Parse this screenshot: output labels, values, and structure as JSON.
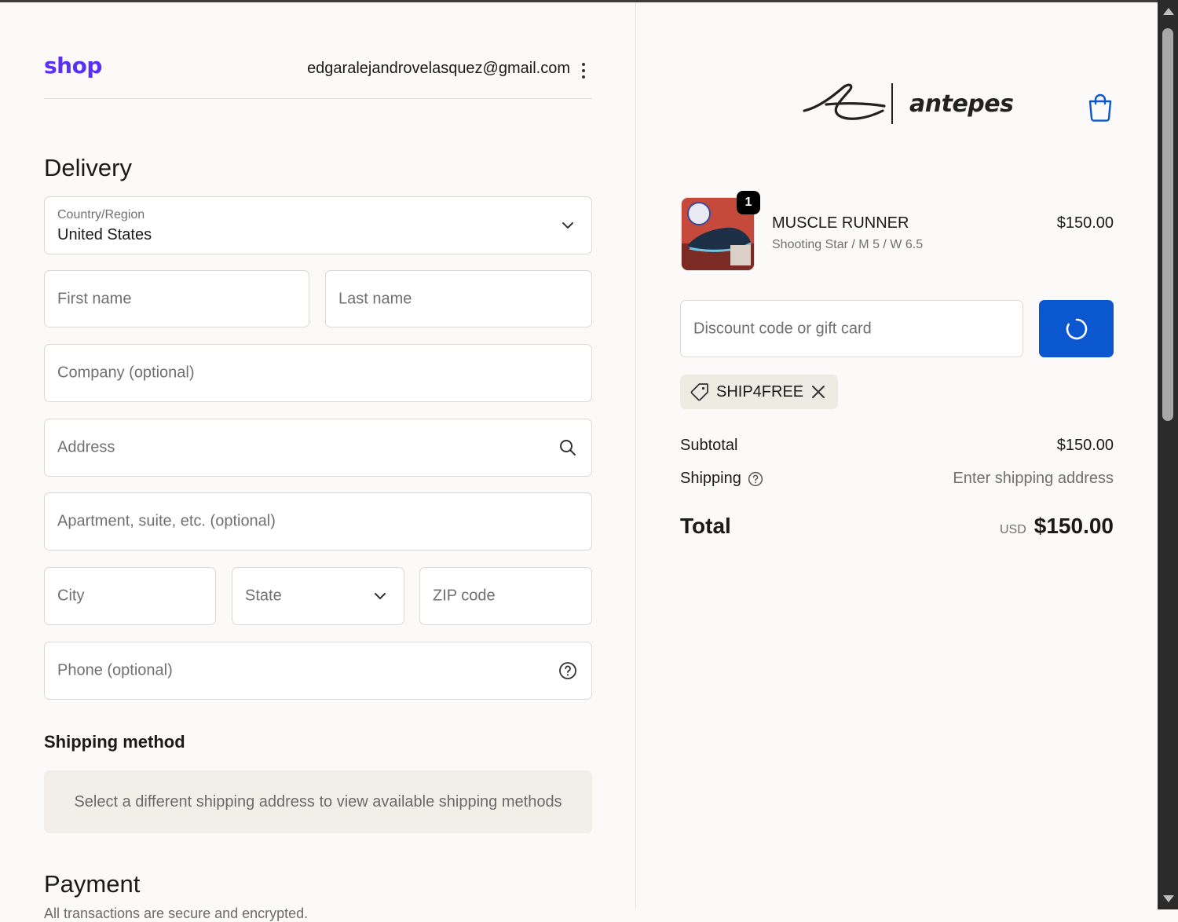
{
  "header": {
    "logo": "shop",
    "email": "edgaralejandrovelasquez@gmail.com"
  },
  "delivery": {
    "title": "Delivery",
    "country_label": "Country/Region",
    "country_value": "United States",
    "first_name_placeholder": "First name",
    "last_name_placeholder": "Last name",
    "company_placeholder": "Company (optional)",
    "address_placeholder": "Address",
    "apartment_placeholder": "Apartment, suite, etc. (optional)",
    "city_placeholder": "City",
    "state_placeholder": "State",
    "zip_placeholder": "ZIP code",
    "phone_placeholder": "Phone (optional)"
  },
  "shipping_method": {
    "title": "Shipping method",
    "note": "Select a different shipping address to view available shipping methods"
  },
  "payment": {
    "title": "Payment",
    "subtitle": "All transactions are secure and encrypted."
  },
  "store": {
    "brand_name": "antepes"
  },
  "cart": {
    "item": {
      "name": "MUSCLE RUNNER",
      "variant": "Shooting Star / M 5 / W 6.5",
      "price": "$150.00",
      "quantity": "1"
    },
    "discount_placeholder": "Discount code or gift card",
    "applied_code": "SHIP4FREE",
    "subtotal_label": "Subtotal",
    "subtotal_value": "$150.00",
    "shipping_label": "Shipping",
    "shipping_value": "Enter shipping address",
    "total_label": "Total",
    "total_currency": "USD",
    "total_value": "$150.00"
  },
  "colors": {
    "shop_brand": "#5a31f4",
    "primary_button": "#0b57d0",
    "background": "#fbfaf8"
  }
}
